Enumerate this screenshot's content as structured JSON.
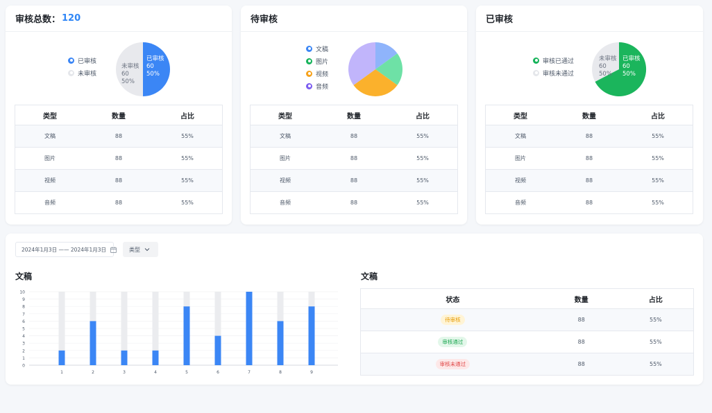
{
  "cards": [
    {
      "title": "审核总数：",
      "count": "120",
      "legend": [
        {
          "label": "已审核",
          "color": "#3b86f5"
        },
        {
          "label": "未审核",
          "color": "#e5e7eb"
        }
      ],
      "pie": [
        {
          "label": "已审核",
          "value": 60,
          "percent": "50%",
          "color": "#3b86f5"
        },
        {
          "label": "未审核",
          "value": 60,
          "percent": "50%",
          "color": "#e8e9ed"
        }
      ],
      "columns": [
        "类型",
        "数量",
        "占比"
      ],
      "rows": [
        [
          "文稿",
          "88",
          "55%"
        ],
        [
          "图片",
          "88",
          "55%"
        ],
        [
          "视频",
          "88",
          "55%"
        ],
        [
          "音频",
          "88",
          "55%"
        ]
      ]
    },
    {
      "title": "待审核",
      "legend": [
        {
          "label": "文稿",
          "color": "#3b86f5"
        },
        {
          "label": "图片",
          "color": "#16b35a"
        },
        {
          "label": "视频",
          "color": "#f7a21b"
        },
        {
          "label": "音频",
          "color": "#7b5cf0"
        }
      ],
      "pie": [
        {
          "label": "文稿",
          "value": 15,
          "color": "#8fb4fb"
        },
        {
          "label": "图片",
          "value": 20,
          "color": "#6ee1a6"
        },
        {
          "label": "视频",
          "value": 30,
          "color": "#fbb12c"
        },
        {
          "label": "音频",
          "value": 35,
          "color": "#c1b5fb"
        }
      ],
      "columns": [
        "类型",
        "数量",
        "占比"
      ],
      "rows": [
        [
          "文稿",
          "88",
          "55%"
        ],
        [
          "图片",
          "88",
          "55%"
        ],
        [
          "视频",
          "88",
          "55%"
        ],
        [
          "音频",
          "88",
          "55%"
        ]
      ]
    },
    {
      "title": "已审核",
      "legend": [
        {
          "label": "审核已通过",
          "color": "#16b35a"
        },
        {
          "label": "审核未通过",
          "color": "#e5e7eb"
        }
      ],
      "pie": [
        {
          "label": "已审核",
          "value": 60,
          "percent": "50%",
          "color": "#1bb55c"
        },
        {
          "label": "未审核",
          "value": 60,
          "percent": "50%",
          "color": "#e8e9ed"
        }
      ],
      "columns": [
        "类型",
        "数量",
        "占比"
      ],
      "rows": [
        [
          "文稿",
          "88",
          "55%"
        ],
        [
          "图片",
          "88",
          "55%"
        ],
        [
          "视频",
          "88",
          "55%"
        ],
        [
          "音频",
          "88",
          "55%"
        ]
      ]
    }
  ],
  "filters": {
    "date_range": "2024年1月3日 —— 2024年1月3日",
    "type_label": "类型"
  },
  "chart_section_title": "文稿",
  "table_section_title": "文稿",
  "chart_data": {
    "type": "bar",
    "categories": [
      "1",
      "2",
      "3",
      "4",
      "5",
      "6",
      "7",
      "8",
      "9"
    ],
    "series": [
      {
        "values": [
          2,
          6,
          2,
          2,
          8,
          4,
          10,
          6,
          8
        ],
        "color": "#3b86f5"
      }
    ],
    "background_values": [
      10,
      10,
      10,
      10,
      10,
      10,
      10,
      10,
      10
    ],
    "ylim": [
      0,
      10
    ],
    "yticks": [
      0,
      1,
      2,
      3,
      4,
      5,
      6,
      7,
      8,
      9,
      10
    ],
    "title": "",
    "xlabel": "",
    "ylabel": ""
  },
  "status_table": {
    "columns": [
      "状态",
      "数量",
      "占比"
    ],
    "rows": [
      {
        "status": "待审核",
        "count": "88",
        "percent": "55%",
        "bg": "#fff4d6",
        "fg": "#e69a00"
      },
      {
        "status": "审核通过",
        "count": "88",
        "percent": "55%",
        "bg": "#e3f7ea",
        "fg": "#19a64f"
      },
      {
        "status": "审核未通过",
        "count": "88",
        "percent": "55%",
        "bg": "#fde8e8",
        "fg": "#e04646"
      }
    ]
  }
}
